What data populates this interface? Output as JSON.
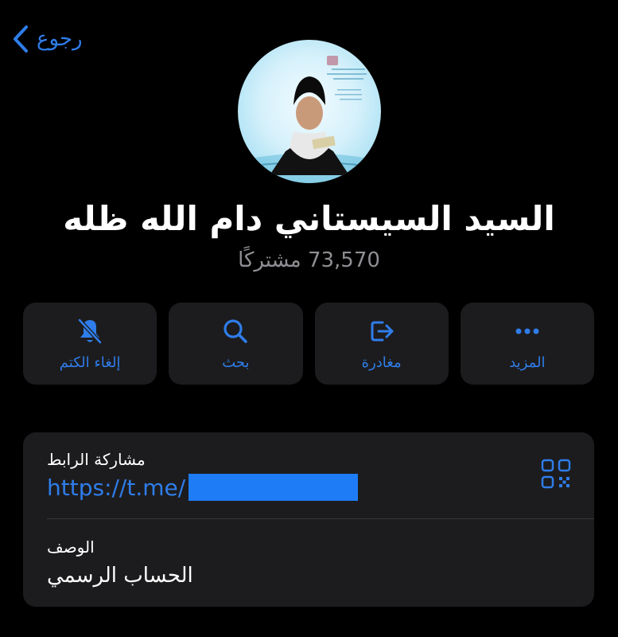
{
  "nav": {
    "back_label": "رجوع"
  },
  "channel": {
    "name": "السيد السيستاني دام الله ظله",
    "subscribers": "73,570 مشتركًا"
  },
  "actions": [
    {
      "label": "إلغاء الكتم",
      "icon": "bell-slash-icon"
    },
    {
      "label": "بحث",
      "icon": "search-icon"
    },
    {
      "label": "مغادرة",
      "icon": "leave-icon"
    },
    {
      "label": "المزيد",
      "icon": "more-dots-icon"
    }
  ],
  "info": {
    "link_label": "مشاركة الرابط",
    "link_value": "https://t.me/",
    "description_label": "الوصف",
    "description_value": "الحساب الرسمي"
  },
  "colors": {
    "accent": "#2f7dea",
    "card": "#1c1c1e",
    "background": "#000000",
    "secondary_text": "#8e8e93"
  }
}
